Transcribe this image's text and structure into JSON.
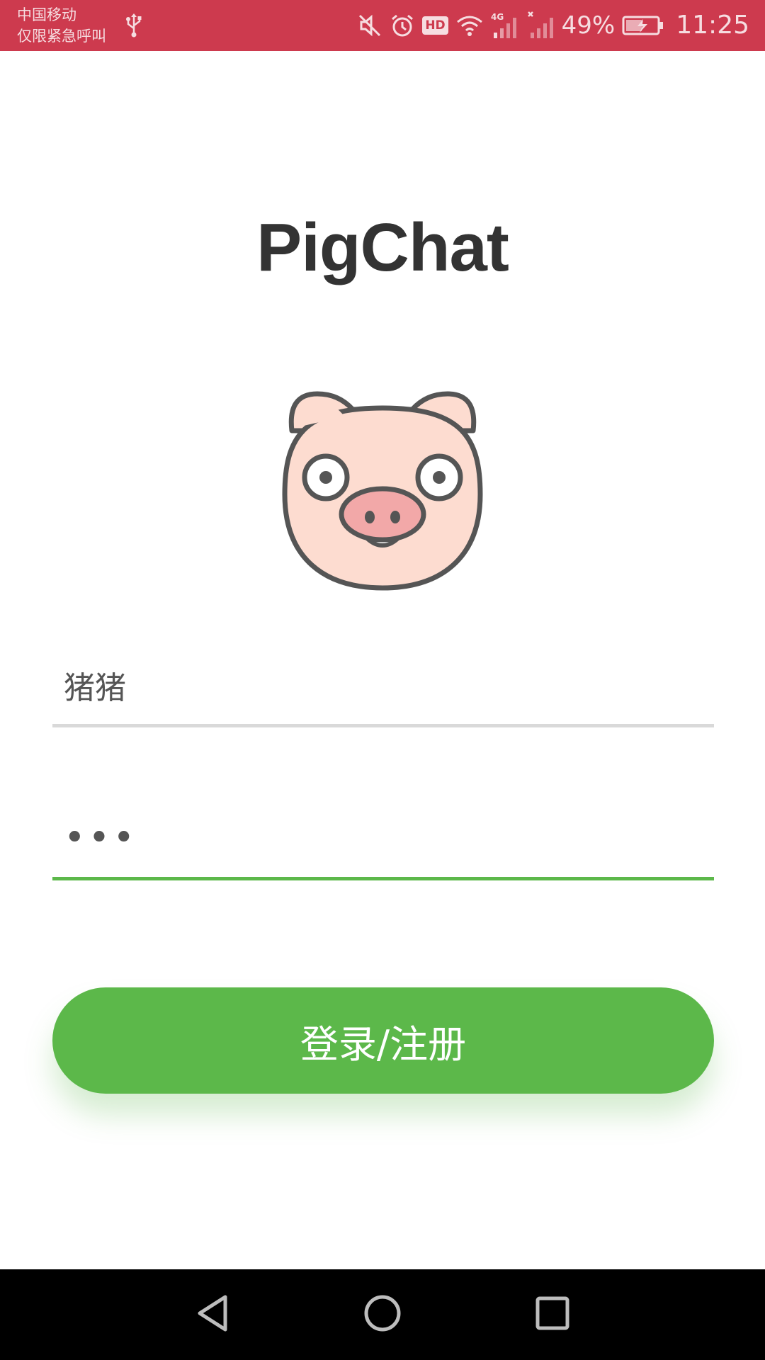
{
  "status_bar": {
    "carrier_line1": "中国移动",
    "carrier_line2": "仅限紧急呼叫",
    "battery_percent": "49%",
    "time": "11:25",
    "hd_label": "HD",
    "network_label": "4G",
    "background_color": "#cd3a4e",
    "icons": [
      "usb-icon",
      "mute-icon",
      "alarm-icon",
      "hd-icon",
      "wifi-icon",
      "signal-4g-icon",
      "signal-no-sim-icon",
      "battery-charging-icon"
    ]
  },
  "app": {
    "title": "PigChat",
    "logo_icon": "pig-face-icon"
  },
  "form": {
    "username_value": "猪猪",
    "password_value": "•••",
    "submit_label": "登录/注册",
    "accent_color": "#5cb84a",
    "inactive_underline_color": "#d9d9d9"
  },
  "nav_bar": {
    "icons": [
      "back-icon",
      "home-icon",
      "recents-icon"
    ]
  }
}
